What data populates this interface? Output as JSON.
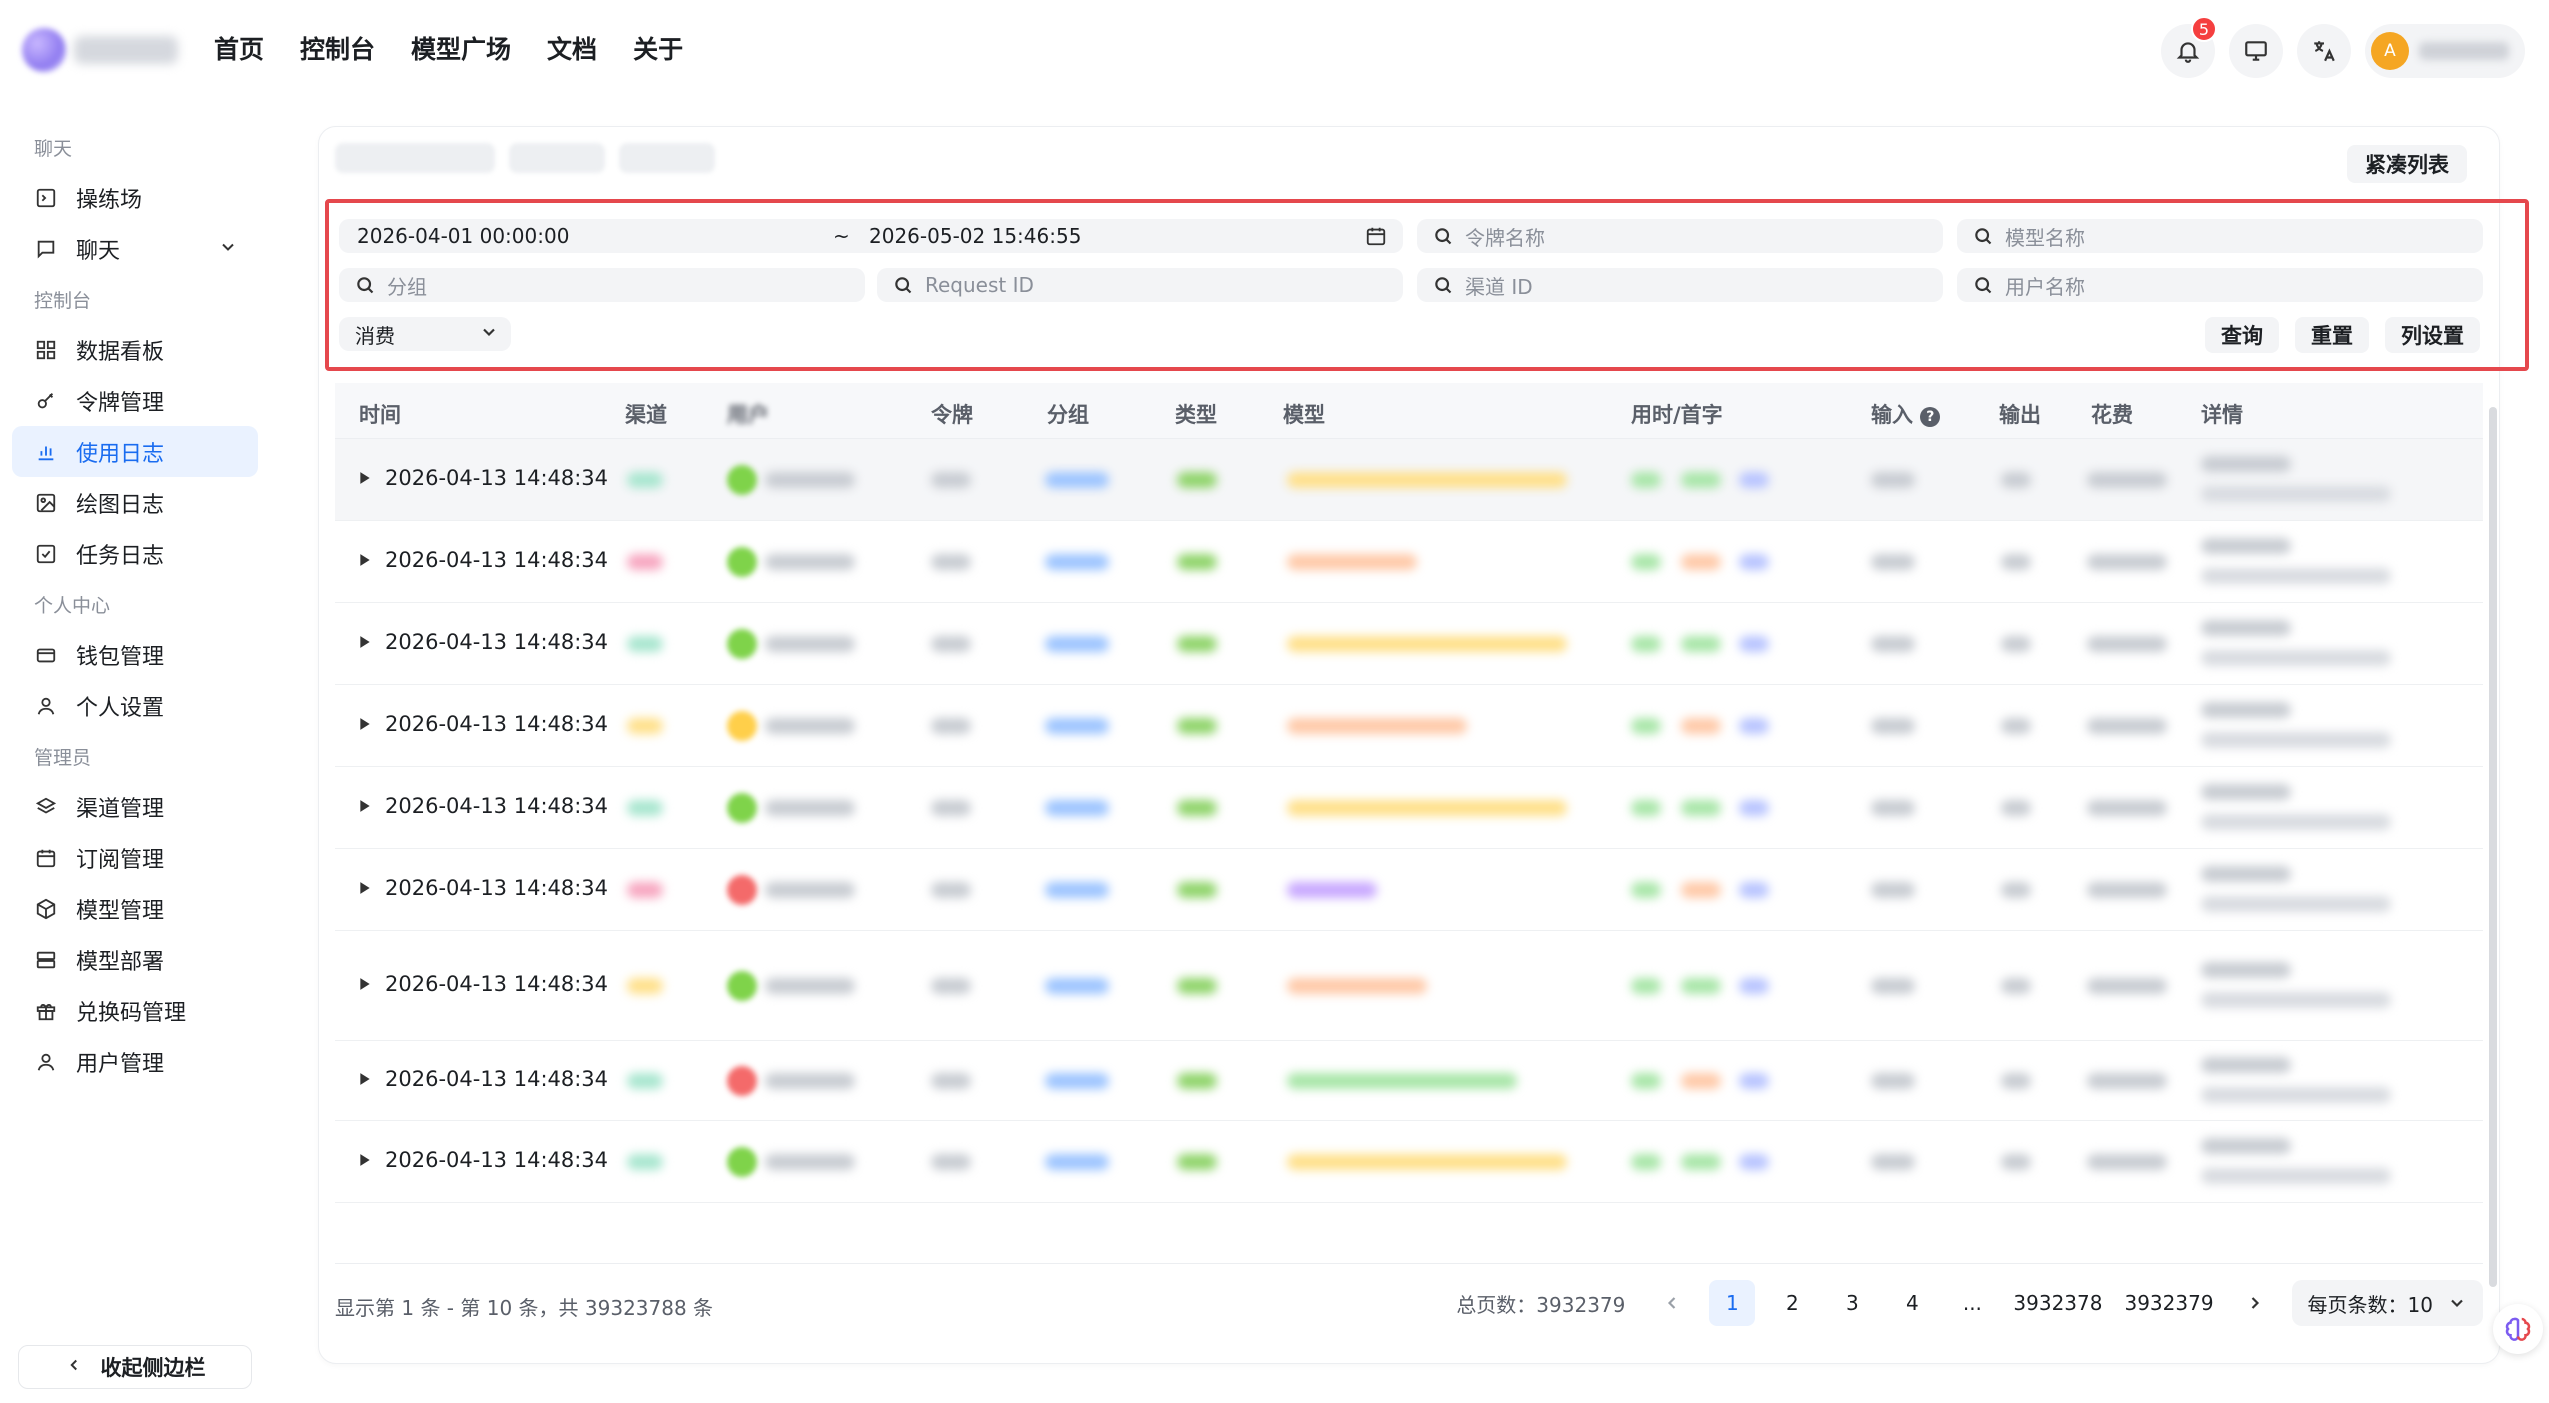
{
  "nav": {
    "items": [
      "首页",
      "控制台",
      "模型广场",
      "文档",
      "关于"
    ]
  },
  "header": {
    "notification_count": "5",
    "avatar_letter": "A"
  },
  "sidebar": {
    "sections": [
      {
        "title": "聊天",
        "items": [
          "操练场",
          "聊天"
        ]
      },
      {
        "title": "控制台",
        "items": [
          "数据看板",
          "令牌管理",
          "使用日志",
          "绘图日志",
          "任务日志"
        ]
      },
      {
        "title": "个人中心",
        "items": [
          "钱包管理",
          "个人设置"
        ]
      },
      {
        "title": "管理员",
        "items": [
          "渠道管理",
          "订阅管理",
          "模型管理",
          "模型部署",
          "兑换码管理",
          "用户管理"
        ]
      }
    ],
    "active_item": "使用日志",
    "collapse_label": "收起侧边栏"
  },
  "toolbar": {
    "compact_label": "紧凑列表"
  },
  "filters": {
    "start_time": "2026-04-01 00:00:00",
    "range_sep": "~",
    "end_time": "2026-05-02 15:46:55",
    "token_name_placeholder": "令牌名称",
    "model_name_placeholder": "模型名称",
    "group_placeholder": "分组",
    "request_id_placeholder": "Request ID",
    "channel_id_placeholder": "渠道 ID",
    "username_placeholder": "用户名称",
    "log_type": "消费",
    "query_label": "查询",
    "reset_label": "重置",
    "columns_label": "列设置"
  },
  "table": {
    "columns": [
      "时间",
      "渠道",
      "用户",
      "令牌",
      "分组",
      "类型",
      "模型",
      "用时/首字",
      "输入",
      "输出",
      "花费",
      "详情"
    ],
    "rows": [
      {
        "time": "2026-04-13 14:48:34"
      },
      {
        "time": "2026-04-13 14:48:34"
      },
      {
        "time": "2026-04-13 14:48:34"
      },
      {
        "time": "2026-04-13 14:48:34"
      },
      {
        "time": "2026-04-13 14:48:34"
      },
      {
        "time": "2026-04-13 14:48:34"
      },
      {
        "time": "2026-04-13 14:48:34"
      },
      {
        "time": "2026-04-13 14:48:34"
      },
      {
        "time": "2026-04-13 14:48:34"
      }
    ]
  },
  "pagination": {
    "summary": "显示第 1 条 - 第 10 条，共 39323788 条",
    "total_pages": "总页数：3932379",
    "pages": [
      "1",
      "2",
      "3",
      "4",
      "...",
      "3932378",
      "3932379"
    ],
    "current_page": "1",
    "per_page_label": "每页条数：10"
  },
  "colors": {
    "accent": "#1a6cf0",
    "highlight_border": "#e5484d",
    "badge": "#f53f3f"
  }
}
